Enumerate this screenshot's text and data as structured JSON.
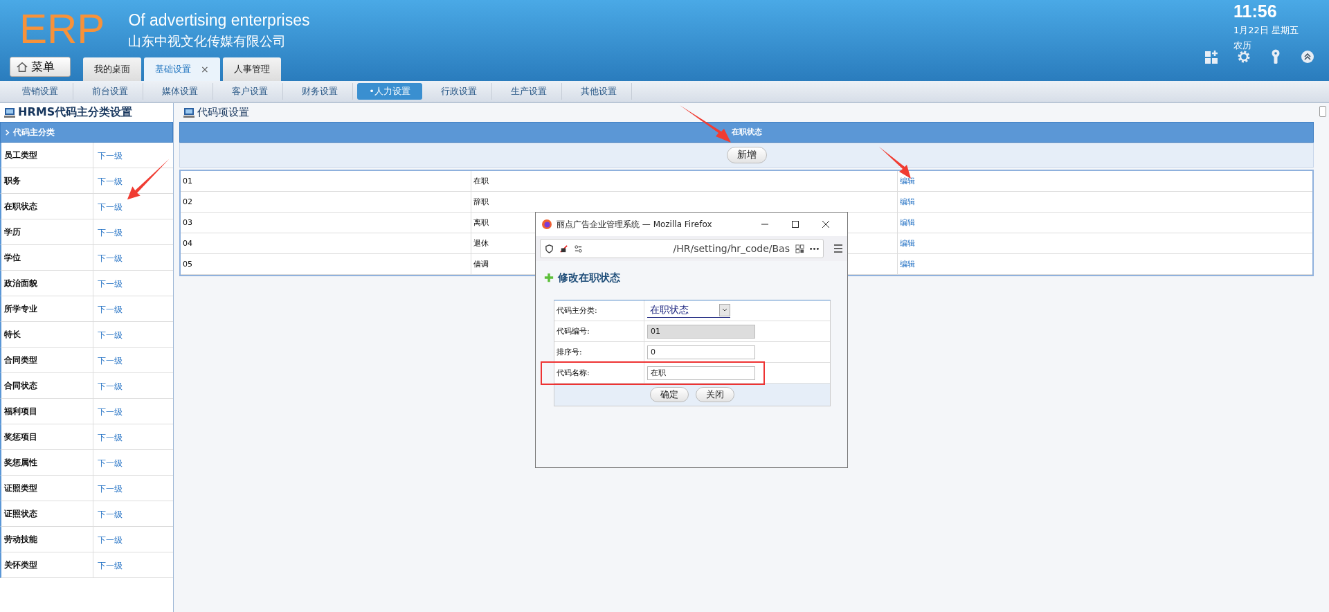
{
  "header": {
    "logo": "ERP",
    "subtitle": "Of advertising enterprises",
    "company": "山东中视文化传媒有限公司",
    "clock": {
      "time": "11:56",
      "date": "1月22日 星期五",
      "lunar": "农历"
    }
  },
  "menu_button": {
    "label": "菜单"
  },
  "tabs": [
    {
      "label": "我的桌面",
      "selected": false
    },
    {
      "label": "基础设置",
      "selected": true,
      "close": "×"
    },
    {
      "label": "人事管理",
      "selected": false
    }
  ],
  "subnav": [
    {
      "label": "营销设置",
      "selected": false
    },
    {
      "label": "前台设置",
      "selected": false
    },
    {
      "label": "媒体设置",
      "selected": false
    },
    {
      "label": "客户设置",
      "selected": false
    },
    {
      "label": "财务设置",
      "selected": false
    },
    {
      "label": "•人力设置",
      "selected": true
    },
    {
      "label": "行政设置",
      "selected": false
    },
    {
      "label": "生产设置",
      "selected": false
    },
    {
      "label": "其他设置",
      "selected": false
    }
  ],
  "sidebar": {
    "title": "HRMS代码主分类设置",
    "header": "代码主分类",
    "items": [
      {
        "name": "员工类型",
        "link": "下一级"
      },
      {
        "name": "职务",
        "link": "下一级"
      },
      {
        "name": "在职状态",
        "link": "下一级"
      },
      {
        "name": "学历",
        "link": "下一级"
      },
      {
        "name": "学位",
        "link": "下一级"
      },
      {
        "name": "政治面貌",
        "link": "下一级"
      },
      {
        "name": "所学专业",
        "link": "下一级"
      },
      {
        "name": "特长",
        "link": "下一级"
      },
      {
        "name": "合同类型",
        "link": "下一级"
      },
      {
        "name": "合同状态",
        "link": "下一级"
      },
      {
        "name": "福利项目",
        "link": "下一级"
      },
      {
        "name": "奖惩项目",
        "link": "下一级"
      },
      {
        "name": "奖惩属性",
        "link": "下一级"
      },
      {
        "name": "证照类型",
        "link": "下一级"
      },
      {
        "name": "证照状态",
        "link": "下一级"
      },
      {
        "name": "劳动技能",
        "link": "下一级"
      },
      {
        "name": "关怀类型",
        "link": "下一级"
      }
    ]
  },
  "main": {
    "title": "代码项设置",
    "table_header": "在职状态",
    "add_button": "新增",
    "rows": [
      {
        "code": "01",
        "name": "在职",
        "action": "编辑"
      },
      {
        "code": "02",
        "name": "辞职",
        "action": "编辑"
      },
      {
        "code": "03",
        "name": "离职",
        "action": "编辑"
      },
      {
        "code": "04",
        "name": "退休",
        "action": "编辑"
      },
      {
        "code": "05",
        "name": "借调",
        "action": "编辑"
      }
    ]
  },
  "dialog": {
    "title": "丽点广告企业管理系统 — Mozilla Firefox",
    "url": "/HR/setting/hr_code/Bas",
    "heading": "修改在职状态",
    "fields": [
      {
        "kind": "select",
        "label": "代码主分类:",
        "value": "在职状态"
      },
      {
        "kind": "text",
        "label": "代码编号:",
        "value": "01",
        "disabled": true
      },
      {
        "kind": "text",
        "label": "排序号:",
        "value": "0",
        "disabled": false
      },
      {
        "kind": "text",
        "label": "代码名称:",
        "value": "在职",
        "disabled": false
      }
    ],
    "buttons": [
      "确定",
      "关闭"
    ]
  }
}
